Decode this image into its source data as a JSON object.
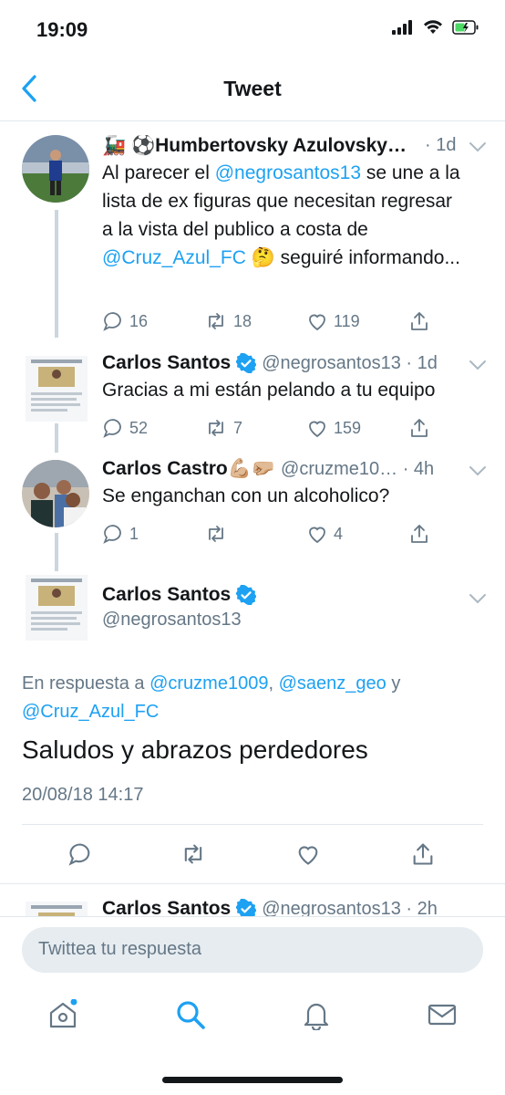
{
  "status_bar": {
    "time": "19:09"
  },
  "nav": {
    "title": "Tweet"
  },
  "tweets": [
    {
      "author": "🚂 ⚽Humbertovsky Azulovsky…",
      "time": "· 1d",
      "body_parts": [
        "Al parecer el ",
        "@negrosantos13",
        " se une a la lista de ex figuras que necesitan regresar a la vista del publico a costa de ",
        "@Cruz_Azul_FC",
        " 🤔 seguiré informando..."
      ],
      "replies": "16",
      "retweets": "18",
      "likes": "119"
    },
    {
      "author": "Carlos Santos",
      "handle": "@negrosantos13 · 1d",
      "body": "Gracias a mi están pelando a tu equipo",
      "replies": "52",
      "retweets": "7",
      "likes": "159"
    },
    {
      "author": "Carlos Castro💪🏼🤛🏼",
      "handle": "@cruzme10… · 4h",
      "body": "Se enganchan con un alcoholico?",
      "replies": "1",
      "retweets": "",
      "likes": "4"
    }
  ],
  "main_tweet": {
    "author": "Carlos Santos",
    "handle": "@negrosantos13",
    "reply_prefix": "En respuesta a ",
    "reply_to": [
      "@cruzme1009",
      "@saenz_geo",
      "@Cruz_Azul_FC"
    ],
    "reply_sep": [
      ", ",
      " y "
    ],
    "text": "Saludos y abrazos perdedores",
    "timestamp": "20/08/18 14:17"
  },
  "next_tweet": {
    "author": "Carlos Santos",
    "handle": "@negrosantos13 · 2h"
  },
  "reply_input": {
    "placeholder": "Twittea tu respuesta"
  },
  "colors": {
    "accent": "#1da1f2",
    "muted": "#657786",
    "verified": "#1da1f2"
  },
  "icons": [
    "back-chevron-icon",
    "comment-icon",
    "retweet-icon",
    "heart-icon",
    "share-icon",
    "home-icon",
    "search-icon",
    "bell-icon",
    "mail-icon"
  ]
}
